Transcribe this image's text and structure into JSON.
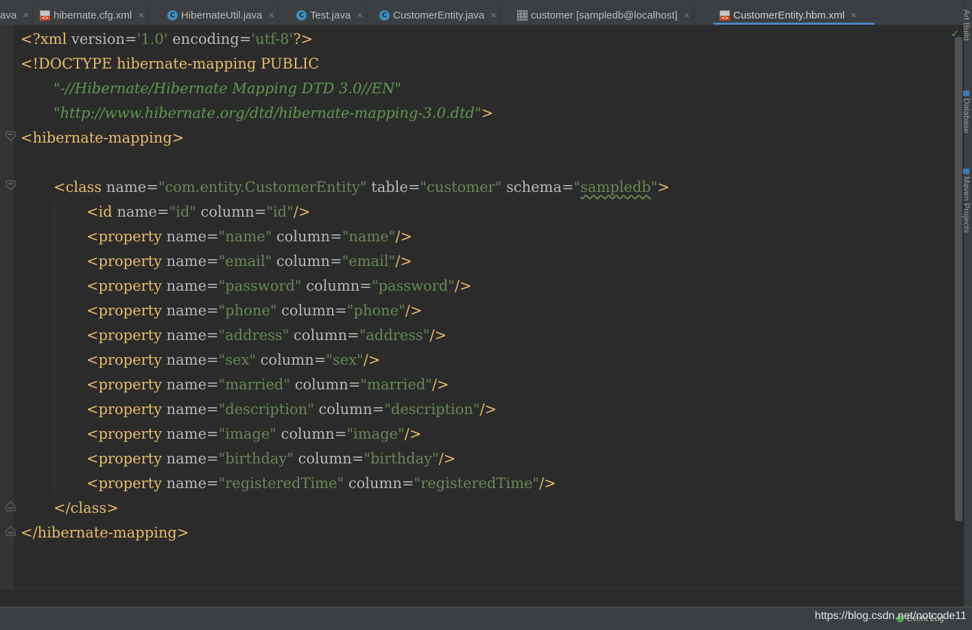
{
  "tabs": [
    {
      "label": "ava",
      "icon": "java-class-icon"
    },
    {
      "label": "hibernate.cfg.xml",
      "icon": "xml-file-icon"
    },
    {
      "label": "HibernateUtil.java",
      "icon": "java-class-icon"
    },
    {
      "label": "Test.java",
      "icon": "java-class-icon"
    },
    {
      "label": "CustomerEntity.java",
      "icon": "java-class-icon"
    },
    {
      "label": "customer [sampledb@localhost]",
      "icon": "database-table-icon"
    },
    {
      "label": "CustomerEntity.hbm.xml",
      "icon": "xml-file-icon",
      "active": true
    }
  ],
  "tab_close_glyph": "×",
  "code": {
    "xml_decl": {
      "open": "<?xml ",
      "version_attr": "version=",
      "version_val": "'1.0'",
      "encoding_attr": " encoding=",
      "encoding_val": "'utf-8'",
      "close": "?>"
    },
    "doctype": {
      "text": "<!DOCTYPE hibernate-mapping PUBLIC",
      "public_id": "\"-//Hibernate/Hibernate Mapping DTD 3.0//EN\"",
      "system_id": "\"http://www.hibernate.org/dtd/hibernate-mapping-3.0.dtd\"",
      "close": ">"
    },
    "root_open": "<hibernate-mapping>",
    "class_line": {
      "tag_open": "<class",
      "name_attr": " name=",
      "name_val": "\"com.entity.CustomerEntity\"",
      "table_attr": " table=",
      "table_val": "\"customer\"",
      "schema_attr": " schema=",
      "schema_val_q1": "\"",
      "schema_val": "sampledb",
      "schema_val_q2": "\"",
      "close": ">"
    },
    "id_line": {
      "tag_open": "<id",
      "name_attr": " name=",
      "name_val": "\"id\"",
      "column_attr": " column=",
      "column_val": "\"id\"",
      "close": "/>"
    },
    "properties": [
      {
        "name": "\"name\"",
        "column": "\"name\""
      },
      {
        "name": "\"email\"",
        "column": "\"email\""
      },
      {
        "name": "\"password\"",
        "column": "\"password\""
      },
      {
        "name": "\"phone\"",
        "column": "\"phone\""
      },
      {
        "name": "\"address\"",
        "column": "\"address\""
      },
      {
        "name": "\"sex\"",
        "column": "\"sex\""
      },
      {
        "name": "\"married\"",
        "column": "\"married\""
      },
      {
        "name": "\"description\"",
        "column": "\"description\""
      },
      {
        "name": "\"image\"",
        "column": "\"image\""
      },
      {
        "name": "\"birthday\"",
        "column": "\"birthday\""
      },
      {
        "name": "\"registeredTime\"",
        "column": "\"registeredTime\""
      }
    ],
    "property_tag": "<property",
    "name_attr": " name=",
    "column_attr": " column=",
    "self_close": "/>",
    "class_close": "</class>",
    "root_close": "</hibernate-mapping>"
  },
  "right_panels": [
    "Art Build",
    "Database",
    "Maven Projects"
  ],
  "status": {
    "event_log": "Event Log",
    "watermark": "https://blog.csdn.net/notcode11"
  },
  "colors": {
    "tag": "#e8bf6a",
    "attr": "#bababa",
    "value": "#6a8759",
    "background": "#2b2b2b",
    "active_tab_underline": "#4a88c7"
  }
}
